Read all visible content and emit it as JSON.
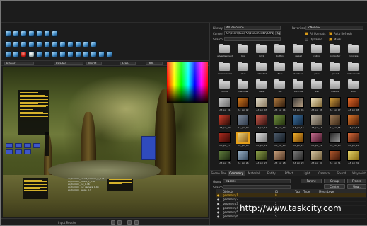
{
  "toolbar": {
    "dropdowns": [
      "Player",
      "Reader",
      "World",
      "Free",
      "DOF"
    ]
  },
  "viewport": {
    "overlay_lines": [
      "ao_horizon_bound_camera_h_0.41",
      "ao_horizon_bound_c_0.68",
      "ao_horizon_cut_0.46",
      "ao_horizon_cut_camera_0.48",
      "ao_horizon_range_0.3"
    ],
    "status_text": "Input Reader"
  },
  "browser": {
    "library_label": "Library",
    "library_value": "All Resource",
    "favorites_label": "Favorites",
    "favorites_value": "<None>",
    "current_label": "Current",
    "current_value": "C:\\Users\\ICX\\PS\\Documents\\ICX\\Demo\\",
    "current_btn": "Up",
    "search_label": "Search",
    "options": {
      "all_formats": "All Formats",
      "auto_refresh": "Auto Refresh",
      "dynamic": "Dynamic",
      "mask": "Mask"
    },
    "folders": [
      "advertisement",
      "box",
      "brick",
      "button",
      "carpet",
      "ceiling",
      "computer",
      "concrete",
      "environments",
      "door",
      "extended",
      "floor",
      "furniture",
      "grids",
      "ground",
      "instruments",
      "lamps",
      "machines",
      "metal",
      "tile",
      "vehicles",
      "wall",
      "window",
      "wood"
    ],
    "thumbs": [
      {
        "caption": "A3_pic_01",
        "colors": [
          "#c9c9c9",
          "#6b6b6b"
        ]
      },
      {
        "caption": "A3_pic_02",
        "colors": [
          "#d27b1e",
          "#4a1e07"
        ]
      },
      {
        "caption": "A3_pic_03",
        "colors": [
          "#e1dbc9",
          "#8c7b61"
        ]
      },
      {
        "caption": "A3_pic_04",
        "colors": [
          "#b07a3f",
          "#2e1a0c"
        ]
      },
      {
        "caption": "A3_pic_05",
        "colors": [
          "#3a3a3a",
          "#b9a184"
        ]
      },
      {
        "caption": "A3_pic_06",
        "colors": [
          "#efe3c0",
          "#7d6532"
        ]
      },
      {
        "caption": "A3_pic_07",
        "colors": [
          "#d8a23c",
          "#3b2310"
        ]
      },
      {
        "caption": "A3_pic_08",
        "colors": [
          "#e46a2a",
          "#602006"
        ]
      },
      {
        "caption": "A3_pic_09",
        "colors": [
          "#cc3c2a",
          "#2b0d07"
        ]
      },
      {
        "caption": "A3_pic_10",
        "colors": [
          "#7e8a9a",
          "#2f3a4b"
        ]
      },
      {
        "caption": "A3_pic_11",
        "colors": [
          "#c85a4b",
          "#351210"
        ]
      },
      {
        "caption": "A3_pic_12",
        "colors": [
          "#6e8d3d",
          "#25330f"
        ]
      },
      {
        "caption": "A3_pic_13",
        "colors": [
          "#3b6f9d",
          "#11243a"
        ]
      },
      {
        "caption": "A3_pic_14",
        "colors": [
          "#b9b0a0",
          "#574d3e"
        ]
      },
      {
        "caption": "A3_pic_15",
        "colors": [
          "#9e7b57",
          "#3a2817"
        ]
      },
      {
        "caption": "A3_pic_16",
        "colors": [
          "#d8742b",
          "#4a1d07"
        ]
      },
      {
        "caption": "A3_pic_17",
        "colors": [
          "#a82a1e",
          "#360905"
        ]
      },
      {
        "caption": "A3_pic_18",
        "colors": [
          "#f0d27a",
          "#8a5b12"
        ],
        "selected": true
      },
      {
        "caption": "A3_pic_19",
        "colors": [
          "#ddd",
          "#777"
        ]
      },
      {
        "caption": "A3_pic_20",
        "colors": [
          "#4b5a6a",
          "#12181f"
        ]
      },
      {
        "caption": "A3_pic_21",
        "colors": [
          "#f2b12a",
          "#6a3a06"
        ]
      },
      {
        "caption": "A3_pic_22",
        "colors": [
          "#c26b8d",
          "#431526"
        ]
      },
      {
        "caption": "A3_pic_23",
        "colors": [
          "#222",
          "#999"
        ]
      },
      {
        "caption": "A3_pic_24",
        "colors": [
          "#d86b3a",
          "#42180a"
        ]
      },
      {
        "caption": "A3_pic_25",
        "colors": [
          "#5f7c3c",
          "#1d2811"
        ]
      },
      {
        "caption": "A3_pic_26",
        "colors": [
          "#9bb3c9",
          "#34475a"
        ]
      },
      {
        "caption": "A3_pic_27",
        "colors": [
          "#8ea24a",
          "#2e3713"
        ]
      },
      {
        "caption": "A3_pic_28",
        "colors": [
          "#c9a07a",
          "#4b3121"
        ]
      },
      {
        "caption": "A3_pic_29",
        "colors": [
          "#7c7c7c",
          "#232323"
        ]
      },
      {
        "caption": "A3_pic_30",
        "colors": [
          "#d8c6a1",
          "#6c5a38"
        ]
      },
      {
        "caption": "A3_pic_31",
        "colors": [
          "#b35a2e",
          "#3a1608"
        ]
      },
      {
        "caption": "A3_pic_32",
        "colors": [
          "#e8d56a",
          "#8a6d12"
        ]
      }
    ]
  },
  "bottom": {
    "tabs": [
      "Scene Tree",
      "Geometry",
      "Material",
      "Entity",
      "Effect",
      "Light",
      "Camera",
      "Sound",
      "Waypoint"
    ],
    "active_tab": "Geometry",
    "group_label": "Group",
    "group_value": "<None>",
    "search_label": "Search",
    "buttons": [
      "Parent",
      "Group",
      "Freeze",
      "Center",
      "Ungr."
    ],
    "table_headers": [
      "Objects",
      "ID",
      "Tag",
      "Type",
      "Mesh Level"
    ],
    "rows": [
      {
        "name": "geometry1",
        "id": "0",
        "selected": true
      },
      {
        "name": "geometry2",
        "id": "1"
      },
      {
        "name": "geometry3",
        "id": "2"
      },
      {
        "name": "geometry4",
        "id": "3"
      },
      {
        "name": "geometry5",
        "id": "4"
      },
      {
        "name": "geometry6",
        "id": "5"
      }
    ]
  },
  "watermark": "http://www.taskcity.com"
}
